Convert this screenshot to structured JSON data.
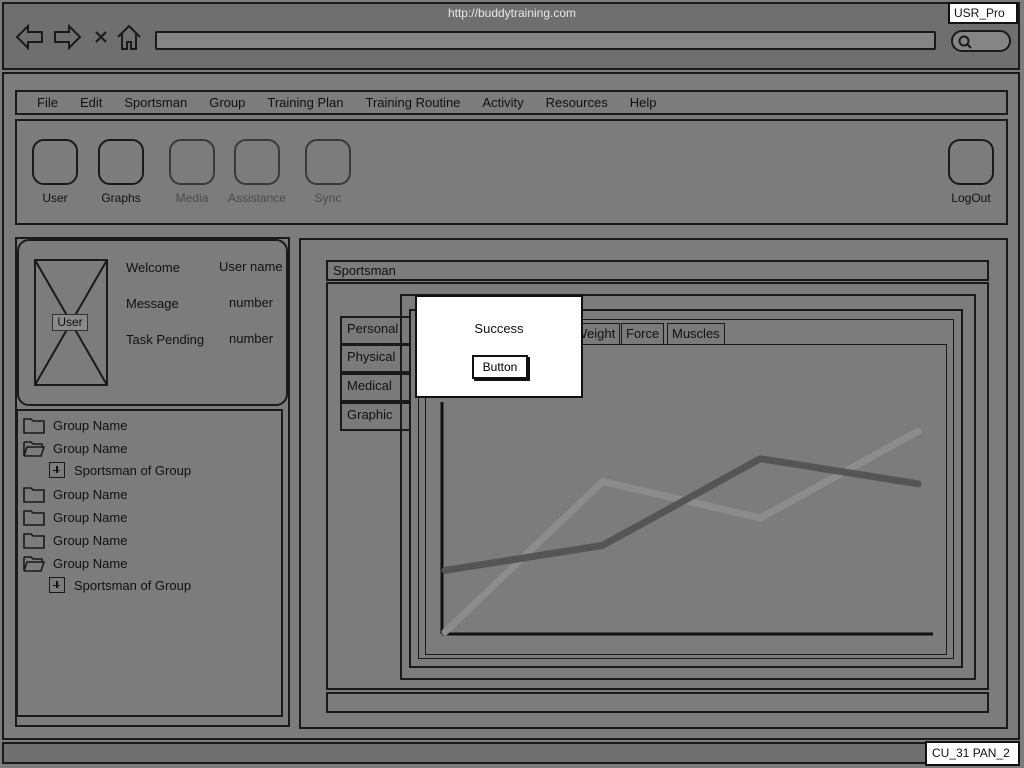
{
  "browser": {
    "url": "http://buddytraining.com",
    "badge": "USR_Pro"
  },
  "menu": [
    "File",
    "Edit",
    "Sportsman",
    "Group",
    "Training Plan",
    "Training Routine",
    "Activity",
    "Resources",
    "Help"
  ],
  "toolbar": {
    "user": "User",
    "graphs": "Graphs",
    "media": "Media",
    "assistance": "Assistance",
    "sync": "Sync",
    "logout": "LogOut"
  },
  "user_card": {
    "image_label": "User",
    "welcome_label": "Welcome",
    "welcome_value": "User name",
    "message_label": "Message",
    "message_value": "number",
    "task_label": "Task Pending",
    "task_value": "number"
  },
  "tree": [
    {
      "type": "folder-closed",
      "label": "Group Name"
    },
    {
      "type": "folder-open",
      "label": "Group Name"
    },
    {
      "type": "child",
      "label": "Sportsman of Group"
    },
    {
      "type": "folder-closed",
      "label": "Group Name"
    },
    {
      "type": "folder-closed",
      "label": "Group Name"
    },
    {
      "type": "folder-closed",
      "label": "Group Name"
    },
    {
      "type": "folder-open",
      "label": "Group Name"
    },
    {
      "type": "child",
      "label": "Sportsman of Group"
    }
  ],
  "panel": {
    "title": "Sportsman",
    "side_tabs": [
      "Personal",
      "Physical",
      "Medical",
      "Graphic"
    ],
    "chart_tabs": [
      "Weight",
      "Force",
      "Muscles"
    ]
  },
  "modal": {
    "title": "Success",
    "button": "Button"
  },
  "status": {
    "badge": "CU_31 PAN_2"
  },
  "chart_data": {
    "type": "line",
    "x": [
      0,
      1,
      2,
      3
    ],
    "series": [
      {
        "values": [
          0.0,
          0.66,
          0.5,
          0.88
        ],
        "color": "#8c8c8c"
      },
      {
        "values": [
          0.27,
          0.38,
          0.76,
          0.65
        ],
        "color": "#555555"
      }
    ],
    "ylim": [
      0,
      1
    ],
    "grid": false
  }
}
